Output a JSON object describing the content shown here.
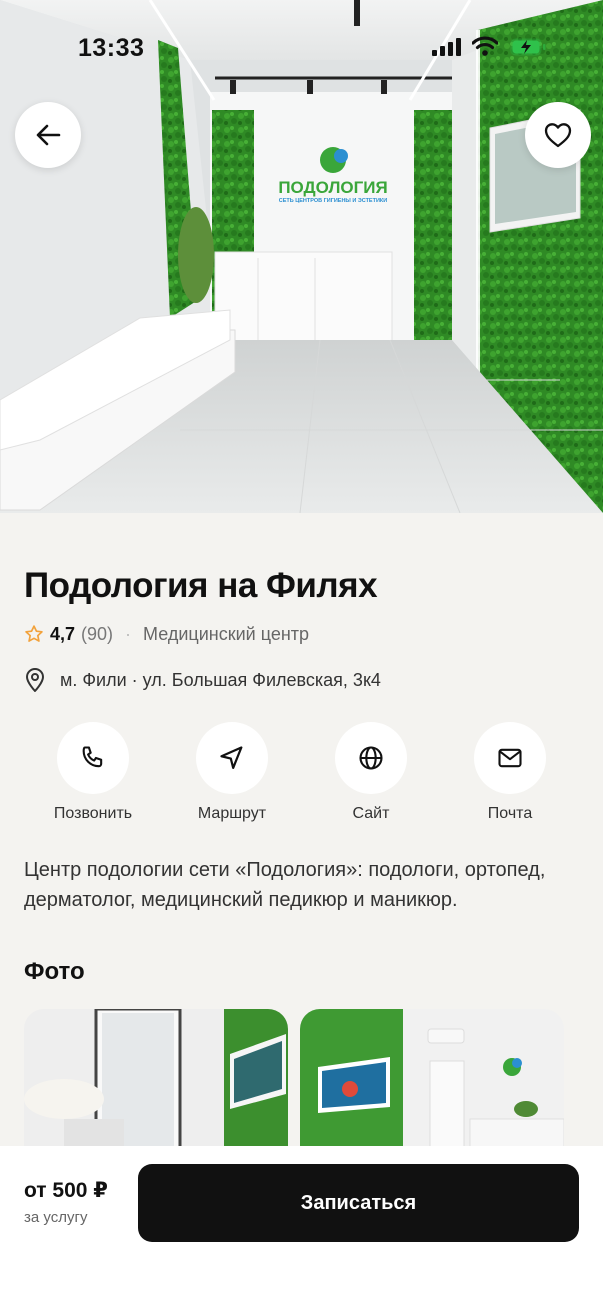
{
  "status_bar": {
    "time": "13:33"
  },
  "hero": {
    "logo_text": "ПОДОЛОГИЯ",
    "logo_subtext": "СЕТЬ ЦЕНТРОВ ГИГИЕНЫ И ЭСТЕТИКИ"
  },
  "place": {
    "title": "Подология на Филях",
    "rating": "4,7",
    "reviews": "(90)",
    "category": "Медицинский центр",
    "address": "м. Фили · ул. Большая Филевская, 3к4"
  },
  "actions": [
    {
      "label": "Позвонить",
      "icon": "phone-icon"
    },
    {
      "label": "Маршрут",
      "icon": "navigation-arrow-icon"
    },
    {
      "label": "Сайт",
      "icon": "globe-icon"
    },
    {
      "label": "Почта",
      "icon": "mail-icon"
    }
  ],
  "description": "Центр подологии сети «Подология»: подологи, ортопед, дерматолог, медицинский педикюр и маникюр.",
  "photos": {
    "heading": "Фото"
  },
  "booking": {
    "price": "от 500 ₽",
    "per": "за услугу",
    "button_label": "Записаться"
  },
  "colors": {
    "accent_green": "#2e8b2a",
    "button_dark": "#111111",
    "background": "#f4f3f0",
    "star": "#f2a23c"
  }
}
